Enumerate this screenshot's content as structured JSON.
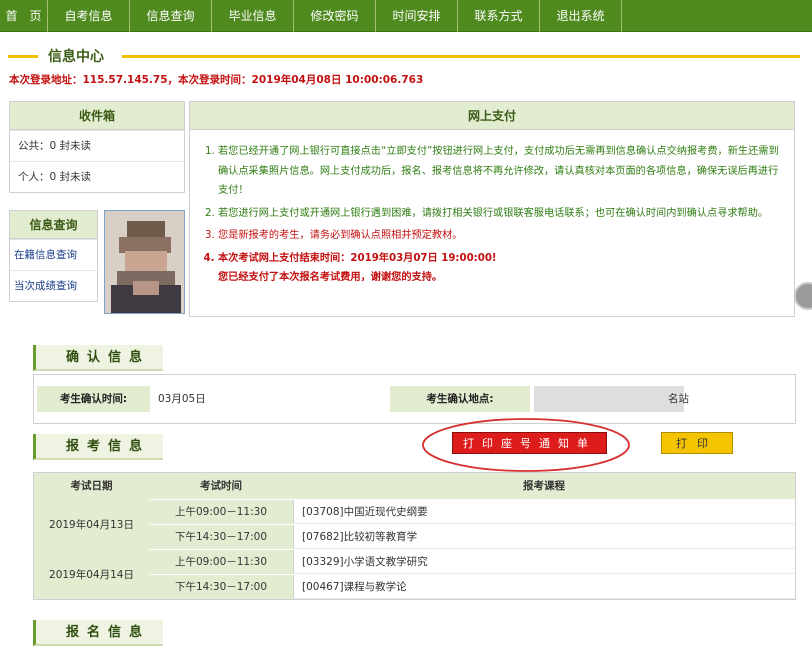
{
  "nav": [
    "首　页",
    "自考信息",
    "信息查询",
    "毕业信息",
    "修改密码",
    "时间安排",
    "联系方式",
    "退出系统"
  ],
  "info_center": {
    "title": "信息中心",
    "login_line": "本次登录地址：115.57.145.75，本次登录时间：2019年04月08日 10:00:06.763"
  },
  "inbox": {
    "title": "收件箱",
    "public": "公共：0 封未读",
    "personal": "个人：0 封未读"
  },
  "query": {
    "title": "信息查询",
    "items": [
      "在籍信息查询",
      "当次成绩查询"
    ]
  },
  "payment": {
    "title": "网上支付",
    "items": [
      "若您已经开通了网上银行可直接点击“立即支付”按钮进行网上支付，支付成功后无需再到信息确认点交纳报考费，新生还需到确认点采集照片信息。网上支付成功后，报名、报考信息将不再允许修改，请认真核对本页面的各项信息，确保无误后再进行支付！",
      "若您进行网上支付或开通网上银行遇到困难，请拨打相关银行或银联客服电话联系；也可在确认时间内到确认点寻求帮助。",
      "您是新报考的考生，请务必到确认点照相并预定教材。",
      "本次考试网上支付结束时间：2019年03月07日 19:00:00!\n您已经支付了本次报名考试费用，谢谢您的支持。"
    ]
  },
  "confirm": {
    "tab": "确认信息",
    "time_label": "考生确认时间:",
    "time_value": "03月05日",
    "place_label": "考生确认地点:",
    "place_value": "名站"
  },
  "exam": {
    "tab": "报考信息",
    "print_ticket": "打印座号通知单",
    "print": "打印",
    "headers": [
      "考试日期",
      "考试时间",
      "报考课程"
    ],
    "days": [
      {
        "date": "2019年04月13日",
        "rows": [
          {
            "time": "上午09:00－11:30",
            "course": "[03708]中国近现代史纲要"
          },
          {
            "time": "下午14:30－17:00",
            "course": "[07682]比较初等教育学"
          }
        ]
      },
      {
        "date": "2019年04月14日",
        "rows": [
          {
            "time": "上午09:00－11:30",
            "course": "[03329]小学语文教学研究"
          },
          {
            "time": "下午14:30－17:00",
            "course": "[00467]课程与教学论"
          }
        ]
      }
    ]
  },
  "signup": {
    "tab": "报名信息"
  }
}
